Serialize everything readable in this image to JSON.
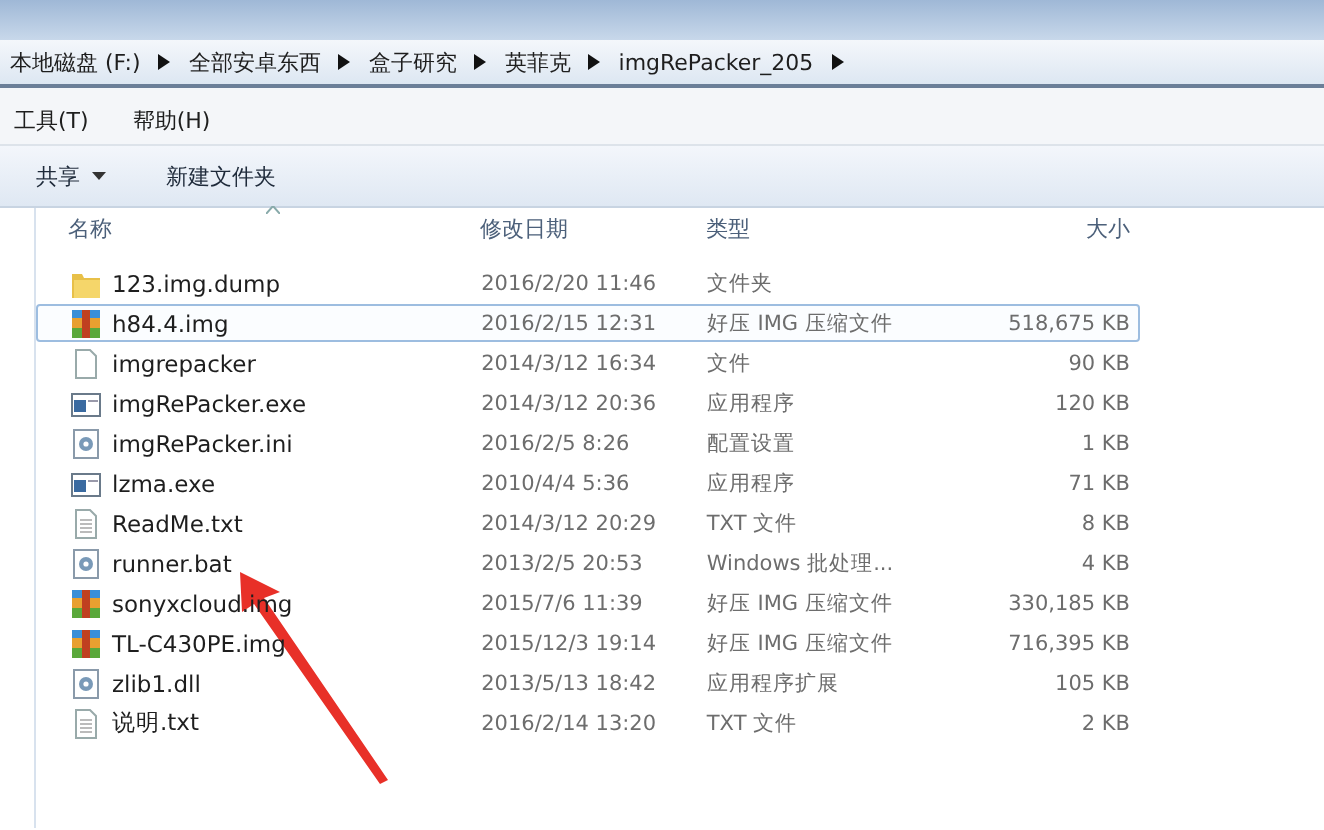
{
  "breadcrumb": [
    "本地磁盘 (F:)",
    "全部安卓东西",
    "盒子研究",
    "英菲克",
    "imgRePacker_205"
  ],
  "menu": [
    "工具(T)",
    "帮助(H)"
  ],
  "toolbar": [
    {
      "label": "共享",
      "dropdown": true
    },
    {
      "label": "新建文件夹",
      "dropdown": false
    }
  ],
  "columns": [
    "名称",
    "修改日期",
    "类型",
    "大小"
  ],
  "files": [
    {
      "name": "123.img.dump",
      "date": "2016/2/20 11:46",
      "type": "文件夹",
      "kind": "folder",
      "selected": false
    },
    {
      "name": "h84.4.img",
      "date": "2016/2/15 12:31",
      "type": "好压 IMG 压缩文件",
      "size": "518,675 KB",
      "kind": "archive",
      "selected": true
    },
    {
      "name": "imgrepacker",
      "date": "2014/3/12 16:34",
      "type": "文件",
      "size": "90 KB",
      "kind": "blank",
      "selected": false
    },
    {
      "name": "imgRePacker.exe",
      "date": "2014/3/12 20:36",
      "type": "应用程序",
      "size": "120 KB",
      "kind": "exe",
      "selected": false
    },
    {
      "name": "imgRePacker.ini",
      "date": "2016/2/5 8:26",
      "type": "配置设置",
      "size": "1 KB",
      "kind": "ini",
      "selected": false
    },
    {
      "name": "lzma.exe",
      "date": "2010/4/4 5:36",
      "type": "应用程序",
      "size": "71 KB",
      "kind": "exe",
      "selected": false
    },
    {
      "name": "ReadMe.txt",
      "date": "2014/3/12 20:29",
      "type": "TXT 文件",
      "size": "8 KB",
      "kind": "txt",
      "selected": false
    },
    {
      "name": "runner.bat",
      "date": "2013/2/5 20:53",
      "type": "Windows 批处理...",
      "size": "4 KB",
      "kind": "bat",
      "selected": false
    },
    {
      "name": "sonyxcloud.img",
      "date": "2015/7/6 11:39",
      "type": "好压 IMG 压缩文件",
      "size": "330,185 KB",
      "kind": "archive",
      "selected": false
    },
    {
      "name": "TL-C430PE.img",
      "date": "2015/12/3 19:14",
      "type": "好压 IMG 压缩文件",
      "size": "716,395 KB",
      "kind": "archive",
      "selected": false
    },
    {
      "name": "zlib1.dll",
      "date": "2013/5/13 18:42",
      "type": "应用程序扩展",
      "size": "105 KB",
      "kind": "dll",
      "selected": false
    },
    {
      "name": "说明.txt",
      "date": "2016/2/14 13:20",
      "type": "TXT 文件",
      "size": "2 KB",
      "kind": "txt",
      "selected": false
    }
  ]
}
